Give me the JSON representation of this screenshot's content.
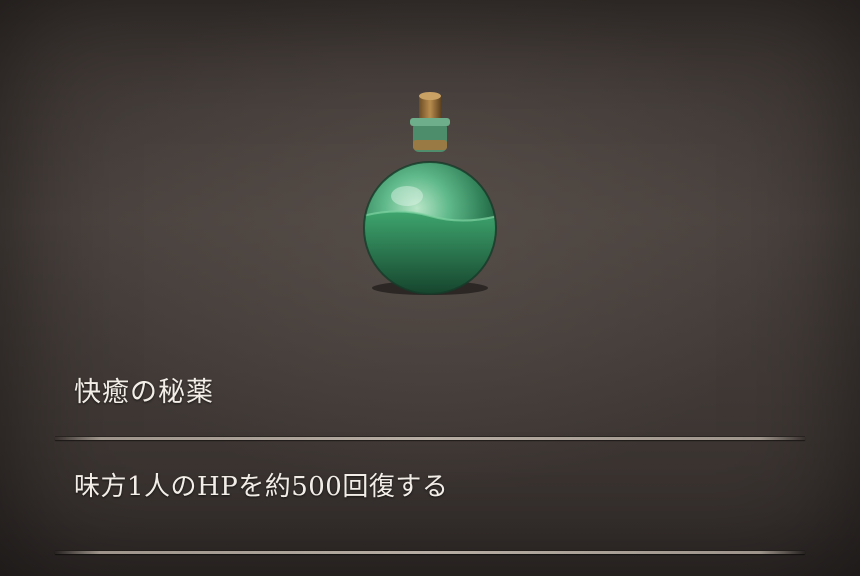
{
  "item": {
    "name": "快癒の秘薬",
    "description": "味方1人のHPを約500回復する",
    "icon": "green-potion-flask-icon"
  },
  "colors": {
    "background": "#423b37",
    "text": "#f2ede6",
    "potion_liquid": "#2f8f5a",
    "cork": "#8a6a3a"
  }
}
